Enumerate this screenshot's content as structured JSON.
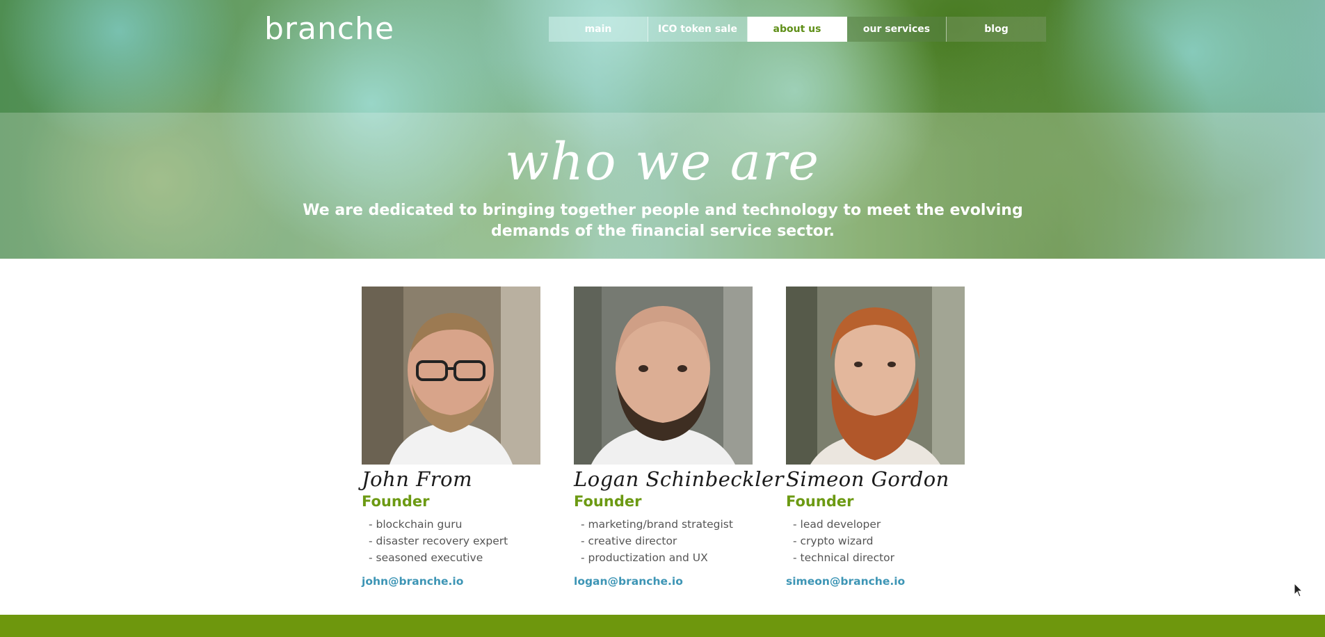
{
  "brand": {
    "logo_text": "branche"
  },
  "nav": {
    "items": [
      {
        "label": "main",
        "active": false
      },
      {
        "label": "ICO token sale",
        "active": false
      },
      {
        "label": "about us",
        "active": true
      },
      {
        "label": "our services",
        "active": false
      },
      {
        "label": "blog",
        "active": false
      }
    ]
  },
  "hero": {
    "title": "who we are",
    "subtitle": "We are dedicated to bringing together people and technology to meet the evolving demands of the financial service sector."
  },
  "team": [
    {
      "name": "John From",
      "role": "Founder",
      "bullets": [
        "- blockchain guru",
        "- disaster recovery expert",
        "- seasoned executive"
      ],
      "email": "john@branche.io"
    },
    {
      "name": "Logan Schinbeckler",
      "role": "Founder",
      "bullets": [
        "- marketing/brand strategist",
        "- creative director",
        "- productization and UX"
      ],
      "email": "logan@branche.io"
    },
    {
      "name": "Simeon Gordon",
      "role": "Founder",
      "bullets": [
        "- lead developer",
        "- crypto wizard",
        "- technical director"
      ],
      "email": "simeon@branche.io"
    }
  ],
  "colors": {
    "accent_green": "#6c9a13",
    "link_blue": "#3d95b5",
    "footer_green": "#6e970d"
  }
}
